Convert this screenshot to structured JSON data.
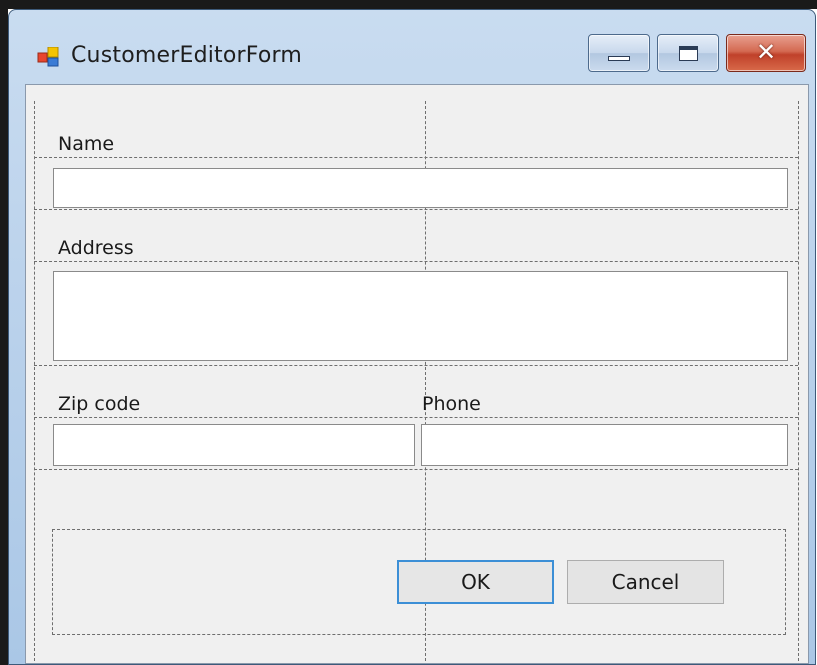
{
  "window": {
    "title": "CustomerEditorForm",
    "icon": "windows-form-icon",
    "controls": {
      "minimize_icon": "minimize-icon",
      "maximize_icon": "maximize-icon",
      "close_label": "✕"
    }
  },
  "form": {
    "name_label": "Name",
    "name_value": "",
    "address_label": "Address",
    "address_value": "",
    "zip_label": "Zip code",
    "zip_value": "",
    "phone_label": "Phone",
    "phone_value": ""
  },
  "buttons": {
    "ok_label": "OK",
    "cancel_label": "Cancel"
  },
  "colors": {
    "focus_accent": "#3c8fd6",
    "close_button": "#c0412a",
    "form_background": "#f0f0f0"
  }
}
